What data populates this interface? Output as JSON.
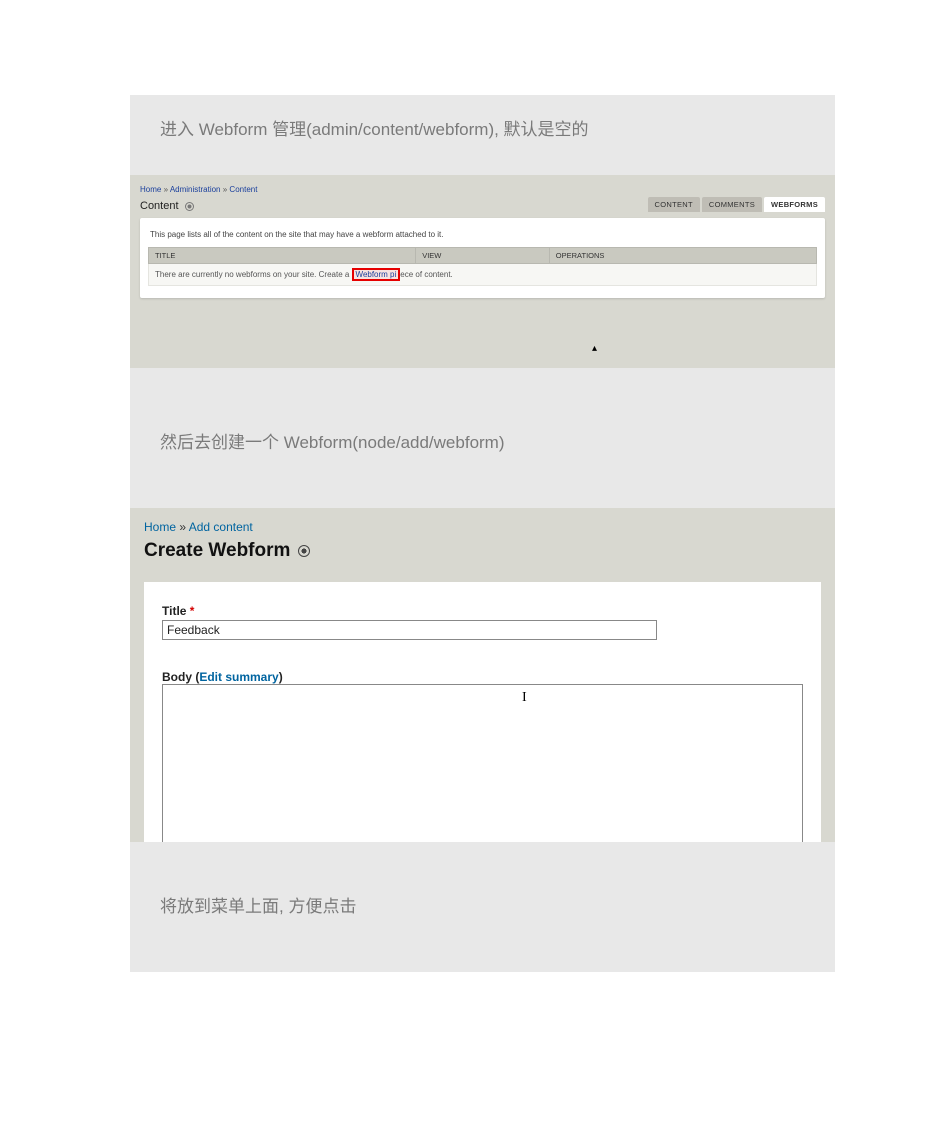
{
  "caption1": "进入 Webform 管理(admin/content/webform),  默认是空的",
  "caption2": "然后去创建一个 Webform(node/add/webform)",
  "caption3": "将放到菜单上面,  方便点击",
  "shot1": {
    "breadcrumb": {
      "home": "Home",
      "admin": "Administration",
      "content": "Content",
      "sep": "»"
    },
    "heading": "Content",
    "tabs": {
      "content": "CONTENT",
      "comments": "COMMENTS",
      "webforms": "WEBFORMS"
    },
    "panel_desc": "This page lists all of the content on the site that may have a webform attached to it.",
    "columns": {
      "title": "TITLE",
      "view": "VIEW",
      "operations": "OPERATIONS"
    },
    "empty_prefix": "There are currently no webforms on your site. Create a ",
    "empty_link": "Webform pi",
    "empty_suffix": "ece of content."
  },
  "shot2": {
    "breadcrumb": {
      "home": "Home",
      "add": "Add content",
      "sep": "»"
    },
    "heading": "Create Webform",
    "title_label": "Title",
    "required_mark": "*",
    "title_value": "Feedback",
    "body_label_prefix": "Body (",
    "body_edit_summary": "Edit summary",
    "body_label_suffix": ")"
  }
}
